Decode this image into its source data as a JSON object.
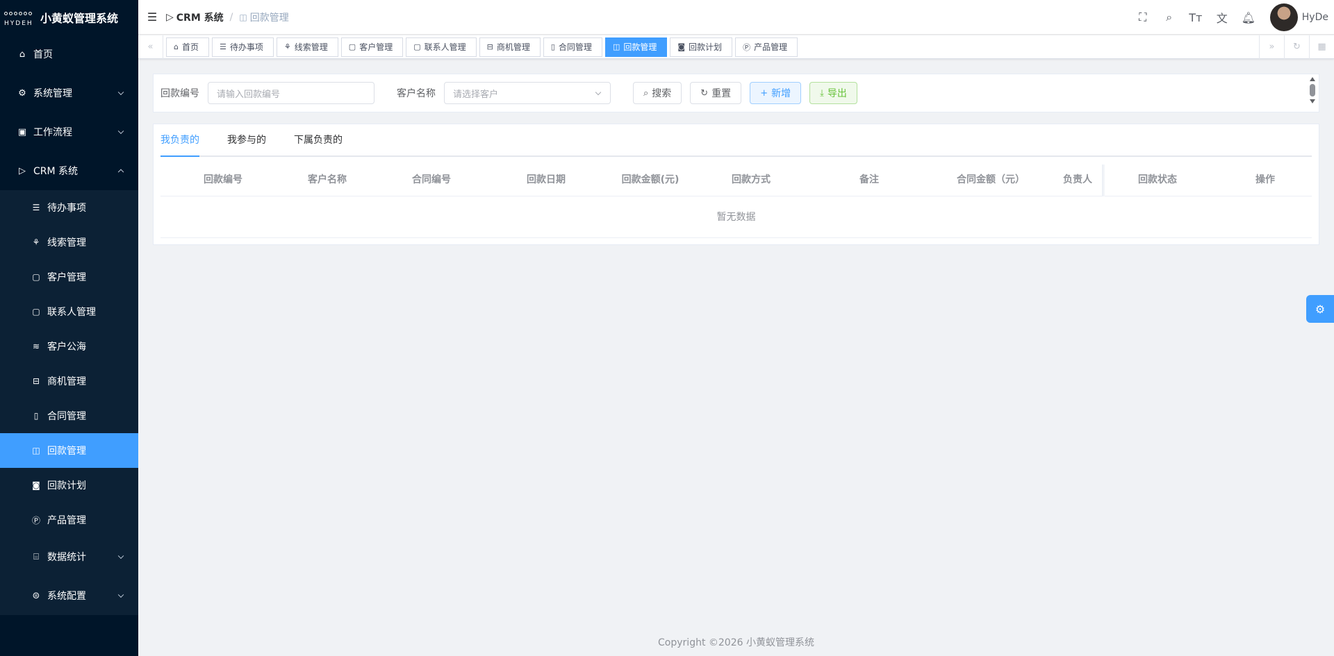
{
  "app": {
    "logo_text": "HYDEH",
    "title": "小黄蚁管理系统"
  },
  "sidebar": {
    "home": "首页",
    "system": "系统管理",
    "workflow": "工作流程",
    "crm": "CRM 系统",
    "crm_items": [
      "待办事项",
      "线索管理",
      "客户管理",
      "联系人管理",
      "客户公海",
      "商机管理",
      "合同管理",
      "回款管理",
      "回款计划",
      "产品管理",
      "数据统计",
      "系统配置"
    ]
  },
  "navbar": {
    "breadcrumb_root": "CRM 系统",
    "breadcrumb_sep": "/",
    "breadcrumb_current": "回款管理",
    "username": "HyDe"
  },
  "tags": [
    "首页",
    "待办事项",
    "线索管理",
    "客户管理",
    "联系人管理",
    "商机管理",
    "合同管理",
    "回款管理",
    "回款计划",
    "产品管理"
  ],
  "filter": {
    "code_label": "回款编号",
    "code_placeholder": "请输入回款编号",
    "customer_label": "客户名称",
    "customer_placeholder": "请选择客户",
    "search": "搜索",
    "reset": "重置",
    "add": "新增",
    "export": "导出"
  },
  "tabs": [
    "我负责的",
    "我参与的",
    "下属负责的"
  ],
  "table": {
    "columns": [
      "回款编号",
      "客户名称",
      "合同编号",
      "回款日期",
      "回款金额(元)",
      "回款方式",
      "备注",
      "合同金额（元）",
      "负责人",
      "回款状态",
      "操作"
    ],
    "empty_text": "暂无数据"
  },
  "footer": "Copyright ©2026 小黄蚁管理系统",
  "colors": {
    "sidebar_bg": "#001529",
    "accent": "#409eff",
    "success": "#67c23a"
  }
}
